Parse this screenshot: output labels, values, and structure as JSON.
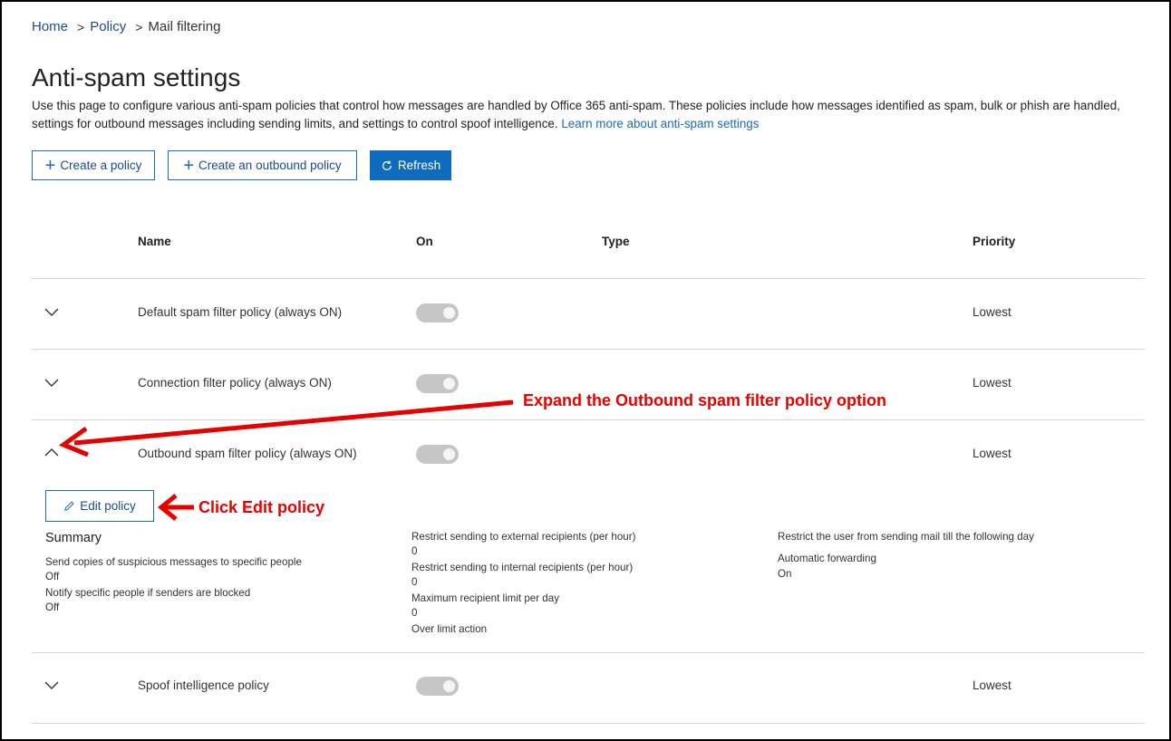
{
  "breadcrumb": {
    "home": "Home",
    "sep1": ">",
    "policy": "Policy",
    "sep2": ">",
    "current": "Mail filtering"
  },
  "page": {
    "title": "Anti-spam settings",
    "description": "Use this page to configure various anti-spam policies that control how messages are handled by Office 365 anti-spam. These policies include how messages identified as spam, bulk or phish are handled, settings for outbound messages including sending limits, and settings to control spoof intelligence.",
    "learn_more": "Learn more about anti-spam settings"
  },
  "toolbar": {
    "create_policy": "Create a policy",
    "create_outbound": "Create an outbound policy",
    "refresh": "Refresh"
  },
  "table": {
    "headers": {
      "name": "Name",
      "on": "On",
      "type": "Type",
      "priority": "Priority"
    },
    "rows": [
      {
        "name": "Default spam filter policy (always ON)",
        "priority": "Lowest",
        "expanded": false
      },
      {
        "name": "Connection filter policy (always ON)",
        "priority": "Lowest",
        "expanded": false
      },
      {
        "name": "Outbound spam filter policy (always ON)",
        "priority": "Lowest",
        "expanded": true
      },
      {
        "name": "Spoof intelligence policy",
        "priority": "Lowest",
        "expanded": false
      }
    ]
  },
  "details": {
    "edit_policy": "Edit policy",
    "summary_title": "Summary",
    "col1": [
      {
        "label": "Send copies of suspicious messages to specific people",
        "value": "Off"
      },
      {
        "label": "Notify specific people if senders are blocked",
        "value": "Off"
      }
    ],
    "col2": [
      {
        "label": "Restrict sending to external recipients (per hour)",
        "value": "0"
      },
      {
        "label": "Restrict sending to internal recipients (per hour)",
        "value": "0"
      },
      {
        "label": "Maximum recipient limit per day",
        "value": "0"
      },
      {
        "label": "Over limit action",
        "value": ""
      }
    ],
    "col3": [
      {
        "label": "Restrict the user from sending mail till the following day",
        "value": ""
      },
      {
        "label": "Automatic forwarding",
        "value": "On"
      }
    ]
  },
  "annotations": {
    "expand": "Expand the Outbound spam filter policy option",
    "click_edit": "Click Edit policy",
    "color": "#e60000"
  },
  "colors": {
    "link": "#1b4c86",
    "primary": "#0f6cbd",
    "toggle_off": "#c6c6c6"
  },
  "icons": [
    "chevron-down-icon",
    "chevron-up-icon",
    "plus-icon",
    "refresh-icon",
    "pencil-icon"
  ]
}
